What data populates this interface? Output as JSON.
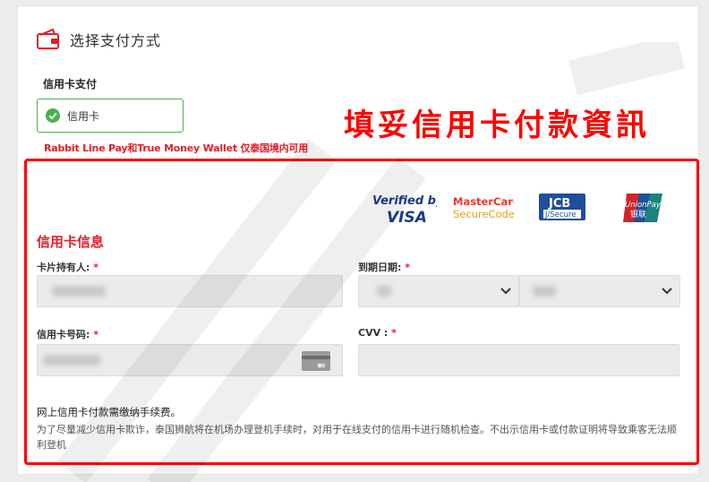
{
  "header": {
    "title": "选择支付方式"
  },
  "payment": {
    "section_label": "信用卡支付",
    "option_label": "信用卡",
    "notice": "Rabbit Line Pay和True Money Wallet 仅泰国境内可用"
  },
  "annotation": "填妥信用卡付款資訊",
  "logos": {
    "visa_line1": "Verified by",
    "visa_line2": "VISA",
    "mc_line1": "MasterCard.",
    "mc_line2": "SecureCode",
    "jcb_line1": "JCB",
    "jcb_line2": "J/Secure",
    "up_line1": "UnionPay",
    "up_line2": "银联"
  },
  "form": {
    "title": "信用卡信息",
    "holder_label": "卡片持有人:",
    "expiry_label": "到期日期:",
    "number_label": "信用卡号码:",
    "cvv_label": "CVV :",
    "required_mark": "*"
  },
  "fee": {
    "title": "网上信用卡付款需缴纳手续费。",
    "text": "为了尽量减少信用卡欺诈，泰国狮航将在机场办理登机手续时，对用于在线支付的信用卡进行随机检查。不出示信用卡或付款证明将导致乘客无法顺利登机"
  },
  "colors": {
    "accent_red": "#e0202a",
    "frame_red": "#ff0000",
    "selected_green": "#4caf50"
  },
  "icons": [
    "wallet-icon",
    "check-circle-icon",
    "chevron-down-icon",
    "credit-card-icon"
  ]
}
